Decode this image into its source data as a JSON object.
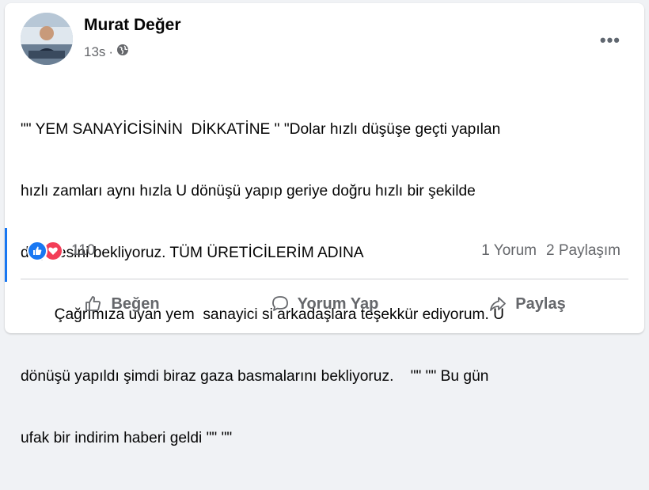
{
  "post": {
    "author": "Murat Değer",
    "time": "13s",
    "separator": "·",
    "privacy_icon": "globe-icon",
    "more_icon": "more-icon",
    "more_label": "•••",
    "text_lines": [
      "\"\" YEM SANAYİCİSİNİN  DİKKATİNE \" \"Dolar hızlı düşüşe geçti yapılan",
      "hızlı zamları aynı hızla U dönüşü yapıp geriye doğru hızlı bir şekilde",
      "düşmesini bekliyoruz. TÜM ÜRETİCİLERİM ADINA",
      "        Çağrımıza uyan yem  sanayici si arkadaşlara teşekkür ediyorum. U",
      "dönüşü yapıldı şimdi biraz gaza basmalarını bekliyoruz.    \"\" \"\" Bu gün",
      "ufak bir indirim haberi geldi \"\" \"\""
    ]
  },
  "reactions": {
    "icons": [
      "like-icon",
      "love-icon"
    ],
    "count": "110",
    "comments": "1 Yorum",
    "shares": "2 Paylaşım"
  },
  "actions": {
    "like": "Beğen",
    "comment": "Yorum Yap",
    "share": "Paylaş"
  },
  "colors": {
    "accent": "#1877f2",
    "love": "#f33e58",
    "secondary_text": "#65676b"
  }
}
